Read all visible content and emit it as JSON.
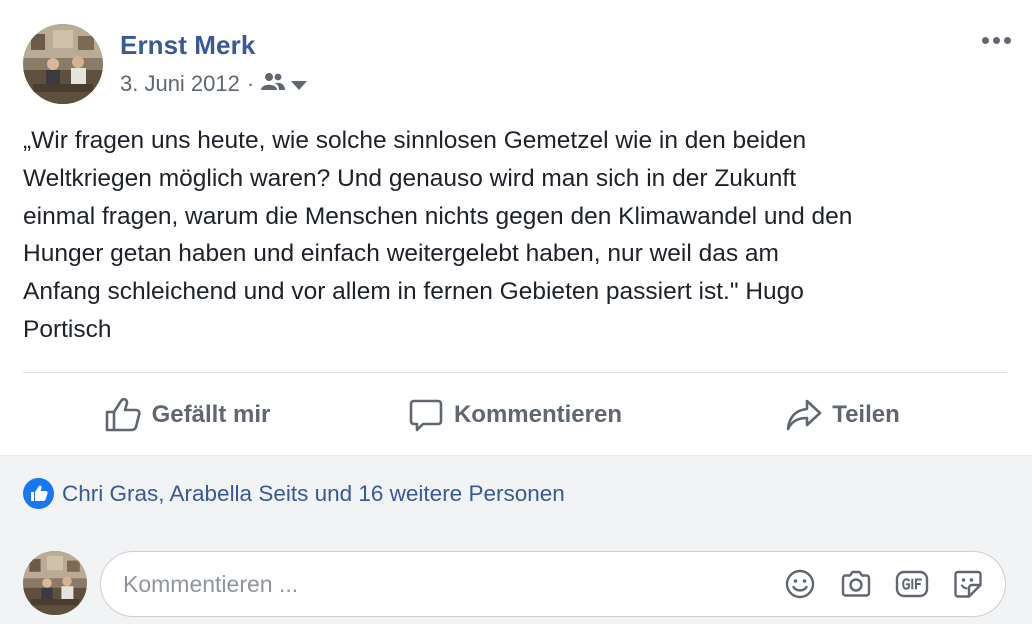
{
  "post": {
    "author": "Ernst Merk",
    "date": "3. Juni 2012",
    "separator": "·",
    "audience_icon": "friends-icon",
    "text": "„Wir fragen uns heute, wie solche sinnlosen Gemetzel wie in den beiden\nWeltkriegen möglich waren? Und genauso wird man sich in der Zukunft\neinmal fragen, warum die Menschen nichts gegen den Klimawandel und den\nHunger getan haben und einfach weitergelebt haben, nur weil das am\nAnfang schleichend und vor allem in fernen Gebieten passiert ist.\" Hugo\nPortisch"
  },
  "actions": {
    "like_label": "Gefällt mir",
    "comment_label": "Kommentieren",
    "share_label": "Teilen"
  },
  "likes": {
    "text": "Chri Gras, Arabella Seits und 16 weitere Personen"
  },
  "comment": {
    "placeholder": "Kommentieren ...",
    "icons": [
      "emoji-icon",
      "camera-icon",
      "gif-icon",
      "sticker-icon"
    ]
  },
  "colors": {
    "link": "#385898",
    "secondary_text": "#606770",
    "like_blue": "#1877f2",
    "strip_bg": "#f2f3f5"
  }
}
